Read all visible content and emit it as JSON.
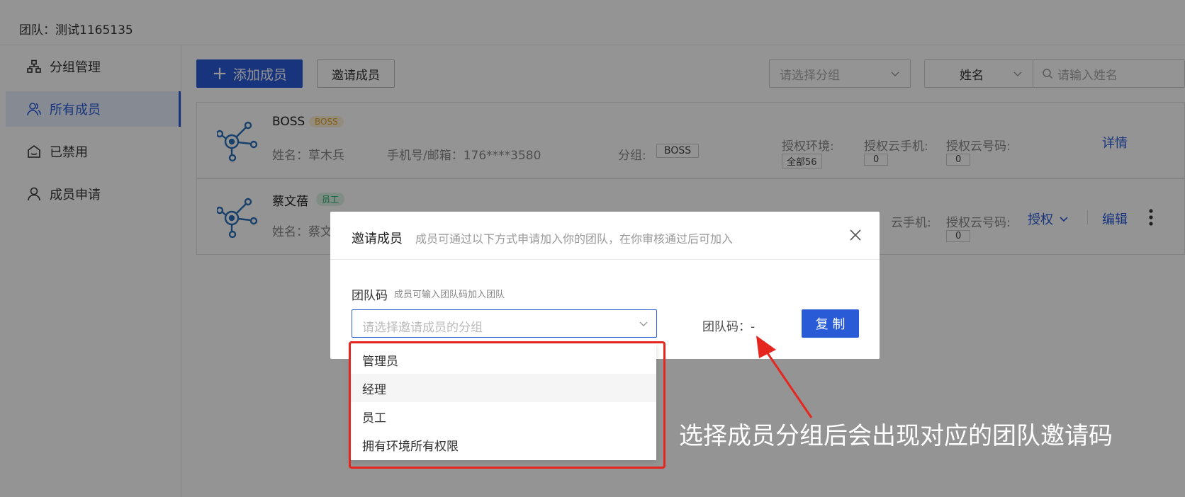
{
  "team": {
    "label": "团队：测试1165135"
  },
  "sidebar": {
    "items": [
      {
        "label": "分组管理",
        "icon": "group-tree-icon",
        "active": false
      },
      {
        "label": "所有成员",
        "icon": "members-icon",
        "active": true
      },
      {
        "label": "已禁用",
        "icon": "disabled-home-icon",
        "active": false
      },
      {
        "label": "成员申请",
        "icon": "user-icon",
        "active": false
      }
    ]
  },
  "toolbar": {
    "add_member": "添加成员",
    "invite_member": "邀请成员",
    "group_placeholder": "请选择分组",
    "field_select": "姓名",
    "search_placeholder": "请输入姓名"
  },
  "members": [
    {
      "title": "BOSS",
      "tag": "BOSS",
      "name_label": "姓名：草木兵",
      "phone_label": "手机号/邮箱：176****3580",
      "group_label": "分组:",
      "group_value": "BOSS",
      "env_label": "授权环境:",
      "env_value": "全部56",
      "phone_cloud_label": "授权云手机:",
      "phone_cloud_value": "0",
      "cloud_code_label": "授权云号码:",
      "cloud_code_value": "0",
      "detail": "详情"
    },
    {
      "title": "蔡文蓓",
      "tag": "员工",
      "name_label": "姓名：蔡文",
      "phone_cloud_label": "云手机:",
      "cloud_code_label": "授权云号码:",
      "cloud_code_value": "0",
      "authorize": "授权",
      "edit": "编辑"
    }
  ],
  "modal": {
    "title": "邀请成员",
    "subtitle": "成员可通过以下方式申请加入你的团队，在你审核通过后可加入",
    "section_label": "团队码",
    "section_hint": "成员可输入团队码加入团队",
    "select_placeholder": "请选择邀请成员的分组",
    "code_label": "团队码：-",
    "copy": "复 制"
  },
  "dropdown_options": [
    "管理员",
    "经理",
    "员工",
    "拥有环境所有权限"
  ],
  "annotation": "选择成员分组后会出现对应的团队邀请码",
  "colors": {
    "primary": "#2a5bd7",
    "annotation": "#e5261f",
    "overlay": "rgba(0,0,0,0.42)"
  }
}
